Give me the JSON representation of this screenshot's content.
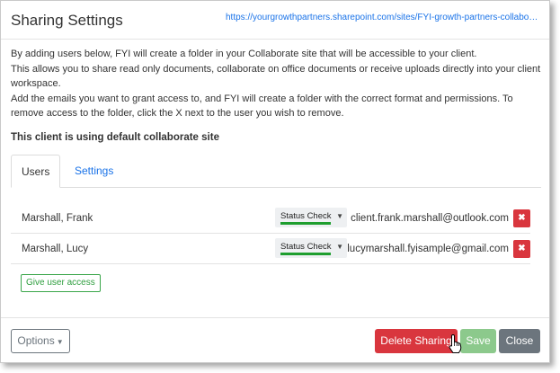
{
  "dialog": {
    "title": "Sharing Settings",
    "site_url": "https://yourgrowthpartners.sharepoint.com/sites/FYI-growth-partners-collaborate-..."
  },
  "description": {
    "line1": "By adding users below, FYI will create a folder in your Collaborate site that will be accessible to your client.",
    "line2": "This allows you to share read only documents, collaborate on office documents or receive uploads directly into your client workspace.",
    "line3": "Add the emails you want to grant access to, and FYI will create a folder with the correct format and permissions. To remove access to the folder, click the X next to the user you wish to remove.",
    "default_site_note": "This client is using default collaborate site"
  },
  "tabs": [
    {
      "label": "Users",
      "active": true
    },
    {
      "label": "Settings",
      "active": false
    }
  ],
  "users": [
    {
      "name": "Marshall, Frank",
      "status": "Status Check",
      "email": "client.frank.marshall@outlook.com",
      "remove_label": "✖"
    },
    {
      "name": "Marshall, Lucy",
      "status": "Status Check",
      "email": "lucymarshall.fyisample@gmail.com",
      "remove_label": "✖"
    }
  ],
  "give_access_label": "Give user access",
  "footer": {
    "options_label": "Options",
    "delete_label": "Delete Sharing",
    "save_label": "Save",
    "close_label": "Close"
  },
  "colors": {
    "link": "#1a73e8",
    "danger": "#d9363e",
    "success": "#1e9e2e",
    "save_disabled": "#8cc98c",
    "secondary": "#6c757d"
  }
}
